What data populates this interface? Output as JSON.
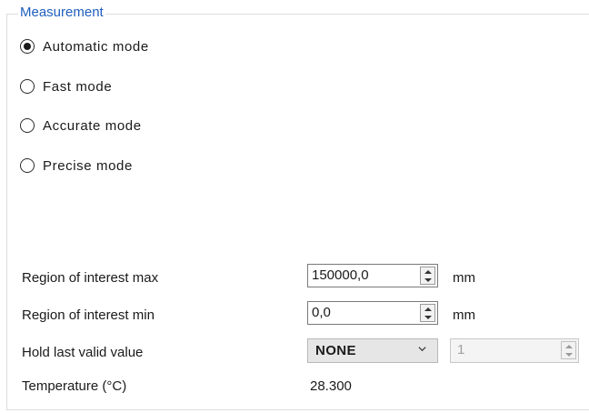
{
  "group": {
    "title": "Measurement"
  },
  "modes": [
    {
      "label": "Automatic mode",
      "selected": true
    },
    {
      "label": "Fast mode",
      "selected": false
    },
    {
      "label": "Accurate mode",
      "selected": false
    },
    {
      "label": "Precise mode",
      "selected": false
    }
  ],
  "roi_max": {
    "label": "Region of interest max",
    "value": "150000,0",
    "unit": "mm"
  },
  "roi_min": {
    "label": "Region of interest min",
    "value": "0,0",
    "unit": "mm"
  },
  "hold": {
    "label": "Hold last valid value",
    "selected": "NONE",
    "count_value": "1"
  },
  "temperature": {
    "label": "Temperature (°C)",
    "value": "28.300"
  },
  "colors": {
    "group_title": "#1f5fbf",
    "border": "#dcdcdc"
  },
  "icons": {
    "spin": "spin-arrows-icon",
    "combo": "chevron-down-icon"
  }
}
